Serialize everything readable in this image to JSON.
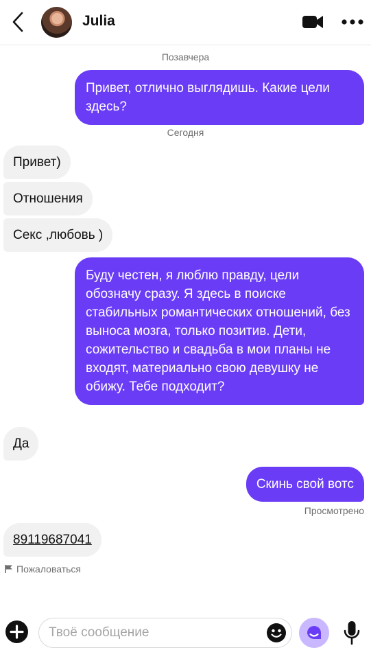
{
  "header": {
    "contact_name": "Julia",
    "icons": [
      "back-arrow-icon",
      "avatar",
      "video-call-icon",
      "more-options-icon"
    ]
  },
  "chat": {
    "date_day_before_yesterday": "Позавчера",
    "date_today": "Сегодня",
    "messages": [
      {
        "dir": "out",
        "text": "Привет, отлично выглядишь. Какие цели здесь?"
      },
      {
        "dir": "in",
        "text": "Привет)"
      },
      {
        "dir": "in",
        "text": "Отношения"
      },
      {
        "dir": "in",
        "text": "Секс ,любовь )"
      },
      {
        "dir": "out",
        "text": "Буду честен, я люблю правду, цели обозначу сразу. Я здесь в поиске стабильных романтических отношений, без выноса мозга, только позитив. Дети, сожительство и свадьба в мои планы не входят, материально свою девушку не обижу. Тебе подходит?"
      },
      {
        "dir": "in",
        "text": "Да"
      },
      {
        "dir": "out",
        "text": "Скинь свой вотс"
      },
      {
        "dir": "in",
        "text": "89119687041"
      }
    ],
    "seen_label": "Просмотрено",
    "report_label": "Пожаловаться"
  },
  "input_bar": {
    "placeholder": "Твоё сообщение",
    "value": ""
  },
  "colors": {
    "outgoing_bubble": "#6a3cf6",
    "incoming_bubble": "#f1f1f1",
    "sticker_button": "#c9b8ff",
    "muted_text": "#6e6e6e"
  }
}
